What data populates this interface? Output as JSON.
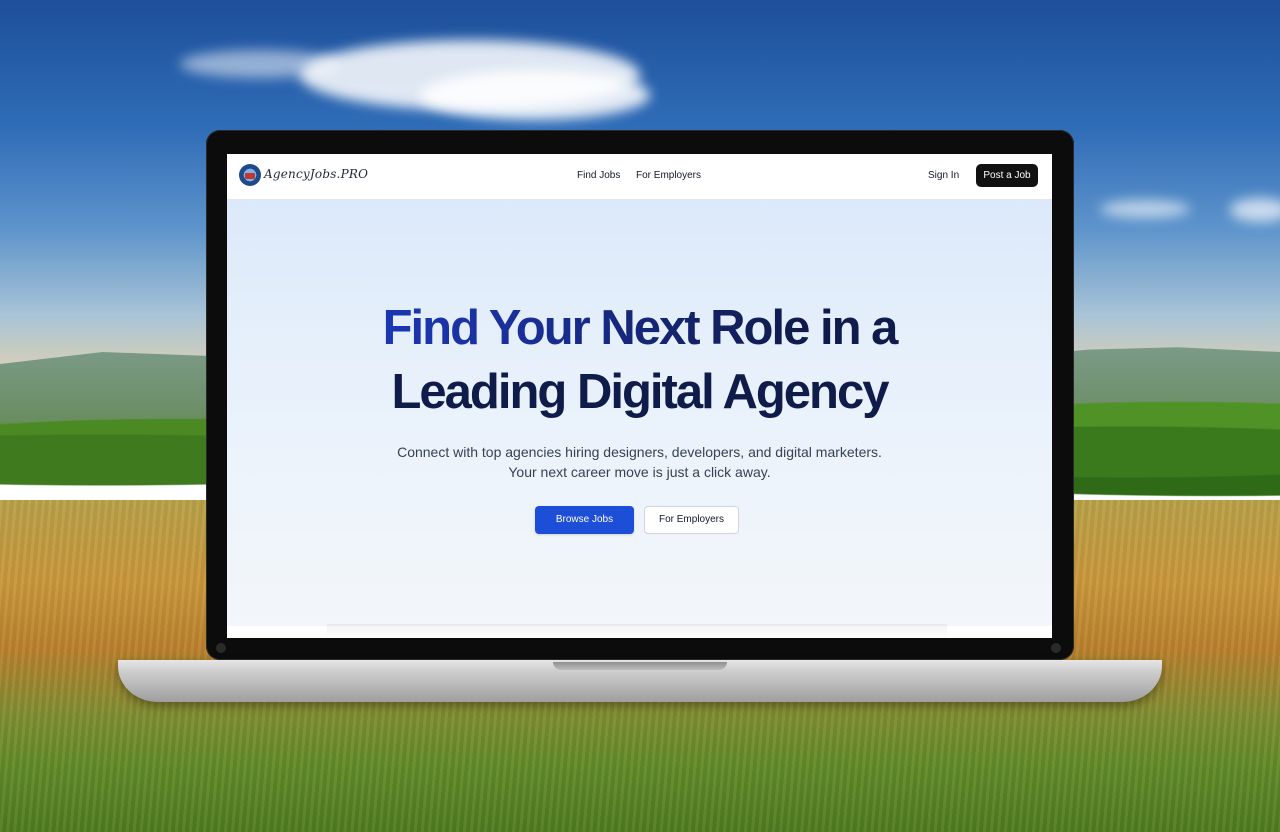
{
  "site": {
    "logo_text": "AgencyJobs.PRO",
    "nav": {
      "find_jobs": "Find Jobs",
      "for_employers": "For Employers"
    },
    "actions": {
      "sign_in": "Sign In",
      "post_job": "Post a Job"
    }
  },
  "hero": {
    "headline_line1": "Find Your Next Role in a",
    "headline_line2": "Leading Digital Agency",
    "subtext": "Connect with top agencies hiring designers, developers, and digital marketers. Your next career move is just a click away.",
    "primary_button": "Browse Jobs",
    "secondary_button": "For Employers"
  },
  "colors": {
    "accent": "#1d4ed8",
    "headline_dark": "#0f1b4a",
    "button_dark": "#111111"
  }
}
